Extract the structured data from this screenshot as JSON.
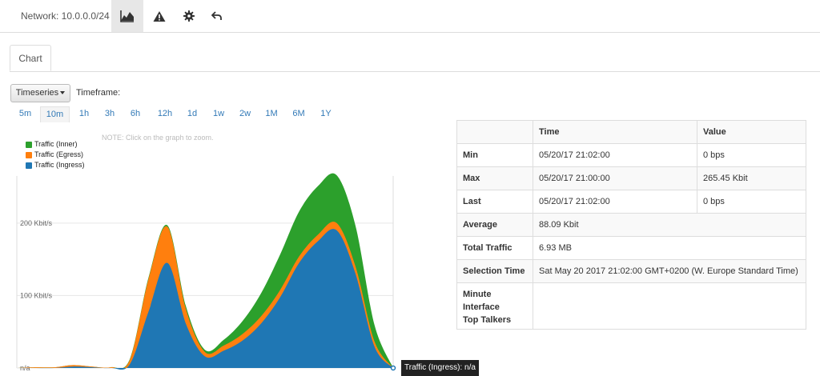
{
  "toolbar": {
    "network_label": "Network: 10.0.0.0/24",
    "icons": [
      "area-chart-icon",
      "warning-icon",
      "gear-icon",
      "undo-icon"
    ]
  },
  "tabs": [
    {
      "label": "Chart",
      "active": true
    }
  ],
  "controls": {
    "view_select": "Timeseries",
    "timeframe_label": "Timeframe:",
    "timeframes": [
      "5m",
      "10m",
      "1h",
      "3h",
      "6h",
      "12h",
      "1d",
      "1w",
      "2w",
      "1M",
      "6M",
      "1Y"
    ],
    "active_timeframe": "10m"
  },
  "chart": {
    "note": "NOTE: Click on the graph to zoom.",
    "tooltip": "Traffic (Ingress): n/a"
  },
  "chart_data": {
    "type": "area",
    "stacked": true,
    "y_tick_labels": [
      "n/a",
      "100 Kbit/s",
      "200 Kbit/s"
    ],
    "y_ticks": [
      0,
      100,
      200
    ],
    "ylim": [
      0,
      265
    ],
    "x": [
      0,
      0.5,
      1,
      1.5,
      2,
      2.5,
      3,
      3.5,
      4,
      4.5,
      5,
      5.5,
      6,
      6.5,
      7,
      7.5,
      8,
      8.5,
      9,
      9.5,
      10
    ],
    "legend_position": "top-left",
    "series": [
      {
        "name": "Traffic (Inner)",
        "color": "#2ca02c",
        "values": [
          0,
          0,
          0,
          0,
          0,
          0,
          1,
          2,
          2,
          4,
          3,
          8,
          18,
          32,
          49,
          62,
          67,
          66,
          56,
          23,
          0
        ]
      },
      {
        "name": "Traffic (Egress)",
        "color": "#ff7f0e",
        "values": [
          0,
          1,
          1,
          2,
          1,
          1,
          6,
          45,
          50,
          20,
          6,
          7,
          9,
          10,
          10,
          9,
          9,
          10,
          10,
          7,
          0
        ]
      },
      {
        "name": "Traffic (Ingress)",
        "color": "#1f77b4",
        "values": [
          0,
          0,
          0,
          2,
          1,
          0,
          5,
          78,
          145,
          60,
          16,
          24,
          38,
          62,
          98,
          145,
          175,
          190,
          130,
          30,
          0
        ]
      }
    ]
  },
  "stats": {
    "headers": [
      "",
      "Time",
      "Value"
    ],
    "rows": [
      {
        "label": "Min",
        "time": "05/20/17 21:02:00",
        "value": "0 bps"
      },
      {
        "label": "Max",
        "time": "05/20/17 21:00:00",
        "value": "265.45 Kbit"
      },
      {
        "label": "Last",
        "time": "05/20/17 21:02:00",
        "value": "0 bps"
      }
    ],
    "average": {
      "label": "Average",
      "value": "88.09 Kbit"
    },
    "total": {
      "label": "Total Traffic",
      "value": "6.93 MB"
    },
    "selection": {
      "label": "Selection Time",
      "value": "Sat May 20 2017 21:02:00 GMT+0200 (W. Europe Standard Time)"
    },
    "talkers": {
      "label": [
        "Minute",
        "Interface",
        "Top Talkers"
      ],
      "value": ""
    }
  }
}
